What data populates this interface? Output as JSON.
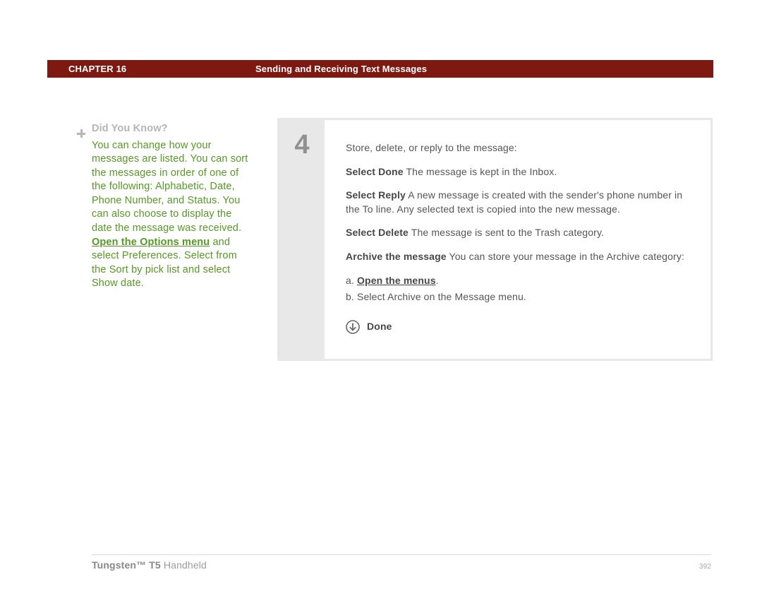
{
  "header": {
    "chapter": "CHAPTER 16",
    "title": "Sending and Receiving Text Messages"
  },
  "sidebar": {
    "heading": "Did You Know?",
    "text_before": "You can change how your messages are listed. You can sort the messages in order of one of the following: Alphabetic, Date, Phone Number, and Status. You can also choose to display the date the message was received. ",
    "link": "Open the Options menu",
    "text_after": " and select Preferences. Select from the Sort by pick list and select Show date."
  },
  "step": {
    "number": "4",
    "intro": "Store, delete, or reply to the message:",
    "opt_done_label": "Select Done",
    "opt_done_text": "   The message is kept in the Inbox.",
    "opt_reply_label": "Select Reply",
    "opt_reply_text": "   A new message is created with the sender's phone number in the To line. Any selected text is copied into the new message.",
    "opt_delete_label": "Select Delete",
    "opt_delete_text": "   The message is sent to the Trash category.",
    "opt_archive_label": "Archive the message",
    "opt_archive_text": "   You can store your message in the Archive category:",
    "sub_a_prefix": "a.  ",
    "sub_a_link": "Open the menus",
    "sub_a_suffix": ".",
    "sub_b": "b.  Select Archive on the Message menu.",
    "done_label": "Done"
  },
  "footer": {
    "product_bold": "Tungsten™ T5",
    "product_rest": " Handheld",
    "page": "392"
  }
}
